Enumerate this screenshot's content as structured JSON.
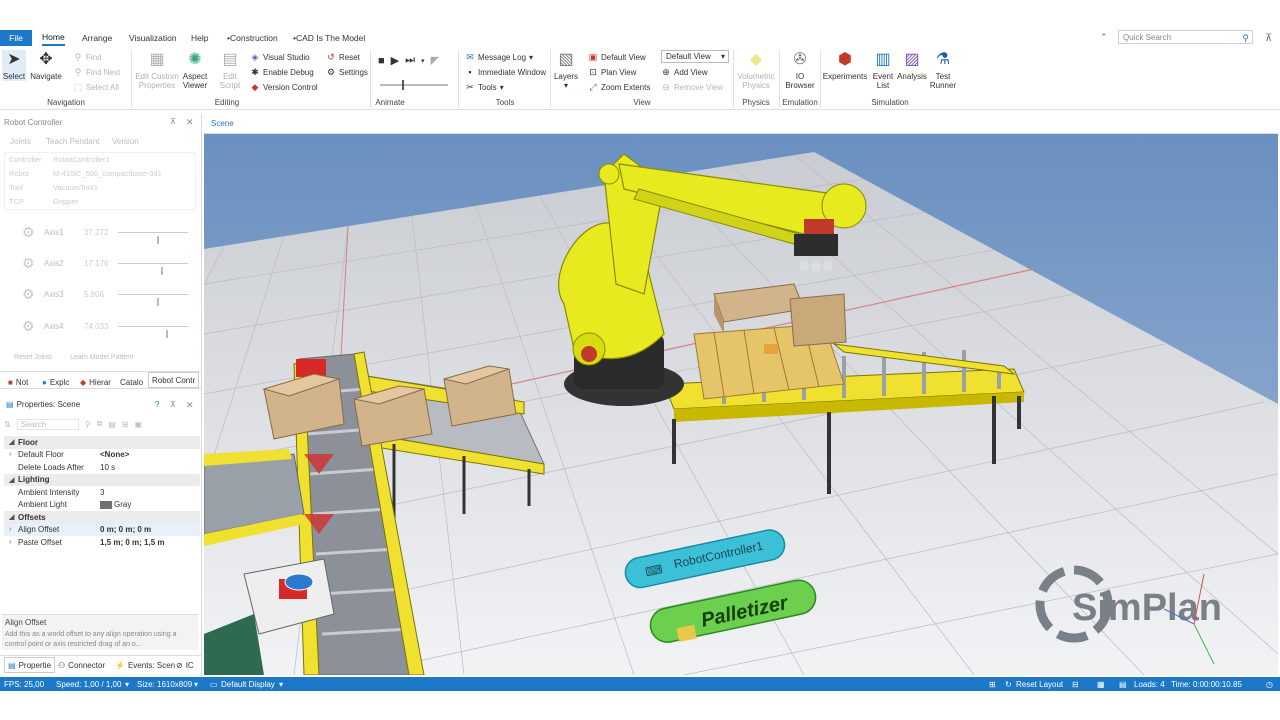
{
  "tabs": {
    "file": "File",
    "items": [
      "Home",
      "Arrange",
      "Visualization",
      "Help",
      "•Construction",
      "•CAD Is The Model"
    ],
    "active": "Home"
  },
  "quick_search": {
    "placeholder": "Quick Search"
  },
  "ribbon": {
    "navigation": {
      "group": "Navigation",
      "select": "Select",
      "navigate": "Navigate"
    },
    "find": {
      "find": "Find",
      "find_next": "Find Next",
      "select_all": "Select All"
    },
    "editing": {
      "group": "Editing",
      "edit_custom": "Edit Custom Properties",
      "aspect_viewer": "Aspect Viewer",
      "edit_script": "Edit Script",
      "visual_studio": "Visual Studio",
      "enable_debug": "Enable Debug",
      "version_control": "Version Control"
    },
    "reset": "Reset",
    "settings": "Settings",
    "animate": {
      "group": "Animate"
    },
    "tools": {
      "group": "Tools",
      "message_log": "Message Log",
      "immediate_window": "Immediate Window",
      "tools": "Tools"
    },
    "layers": "Layers",
    "view": {
      "group": "View",
      "default_view": "Default View",
      "plan_view": "Plan View",
      "zoom_extents": "Zoom Extents",
      "view_select": "Default View",
      "add_view": "Add View",
      "remove_view": "Remove View"
    },
    "physics": {
      "group": "Physics",
      "volumetric": "Volumetric Physics"
    },
    "emulation": {
      "group": "Emulation",
      "io_browser": "IO Browser"
    },
    "simulation": {
      "group": "Simulation",
      "experiments": "Experiments",
      "event_list": "Event List",
      "analysis": "Analysis",
      "test_runner": "Test Runner"
    }
  },
  "robot_controller": {
    "title": "Robot Controller",
    "tabs": [
      "Joints",
      "Teach Pendant",
      "Version"
    ],
    "fields": [
      {
        "label": "Controller",
        "value": "RobotController1"
      },
      {
        "label": "Robot",
        "value": "M-410iC_500_compactbase-3d1"
      },
      {
        "label": "Tool",
        "value": "VacuumTool1"
      },
      {
        "label": "TCP",
        "value": "Gripper"
      }
    ],
    "axes": [
      {
        "label": "Axis1",
        "value": "37.272",
        "pos": 0.55
      },
      {
        "label": "Axis2",
        "value": "17.176",
        "pos": 0.62
      },
      {
        "label": "Axis3",
        "value": "5.806",
        "pos": 0.55
      },
      {
        "label": "Axis4",
        "value": "74.033",
        "pos": 0.68
      }
    ],
    "buttons": [
      "Reset Joints",
      "Learn Model Pattern"
    ]
  },
  "panel_tabs": [
    "Not",
    "Explc",
    "Hierar",
    "Catalo",
    "Robot Contr"
  ],
  "properties": {
    "title": "Properties: Scene",
    "search": "Search",
    "rows": [
      {
        "type": "section",
        "key": "Floor"
      },
      {
        "type": "row",
        "key": "Default Floor",
        "value": "<None>",
        "bold": true
      },
      {
        "type": "row",
        "key": "Delete Loads After",
        "value": "10 s"
      },
      {
        "type": "section",
        "key": "Lighting"
      },
      {
        "type": "row",
        "key": "Ambient Intensity",
        "value": "3"
      },
      {
        "type": "row",
        "key": "Ambient Light",
        "value": "Gray",
        "swatch": "#707070"
      },
      {
        "type": "section",
        "key": "Offsets"
      },
      {
        "type": "row",
        "key": "Align Offset",
        "value": "0 m; 0 m; 0 m",
        "bold": true,
        "expand": true
      },
      {
        "type": "row",
        "key": "Paste Offset",
        "value": "1,5 m; 0 m; 1,5 m",
        "bold": true,
        "expand": true
      }
    ],
    "help_title": "Align Offset",
    "help_text": "Add this as a world offset to any align operation using a control point or axis restricted drag of an o..."
  },
  "bottom_tabs": [
    "Propertie",
    "Connector",
    "Events: Scen",
    "IC"
  ],
  "scene": {
    "tab": "Scene",
    "controller_label": "RobotController1",
    "palletizer_label": "Palletizer",
    "brand": "SimPlan"
  },
  "status": {
    "fps": "FPS: 25,00",
    "speed": "Speed: 1,00 / 1,00",
    "size": "Size: 1610x809",
    "display": "Default Display",
    "reset_layout": "Reset Layout",
    "loads": "Loads: 4",
    "time": "Time: 0:00:00:10.85"
  },
  "colors": {
    "accent": "#1e78c8",
    "robot": "#e6ea1e",
    "floor": "#e8eaee",
    "sky": "#6f94c2"
  }
}
